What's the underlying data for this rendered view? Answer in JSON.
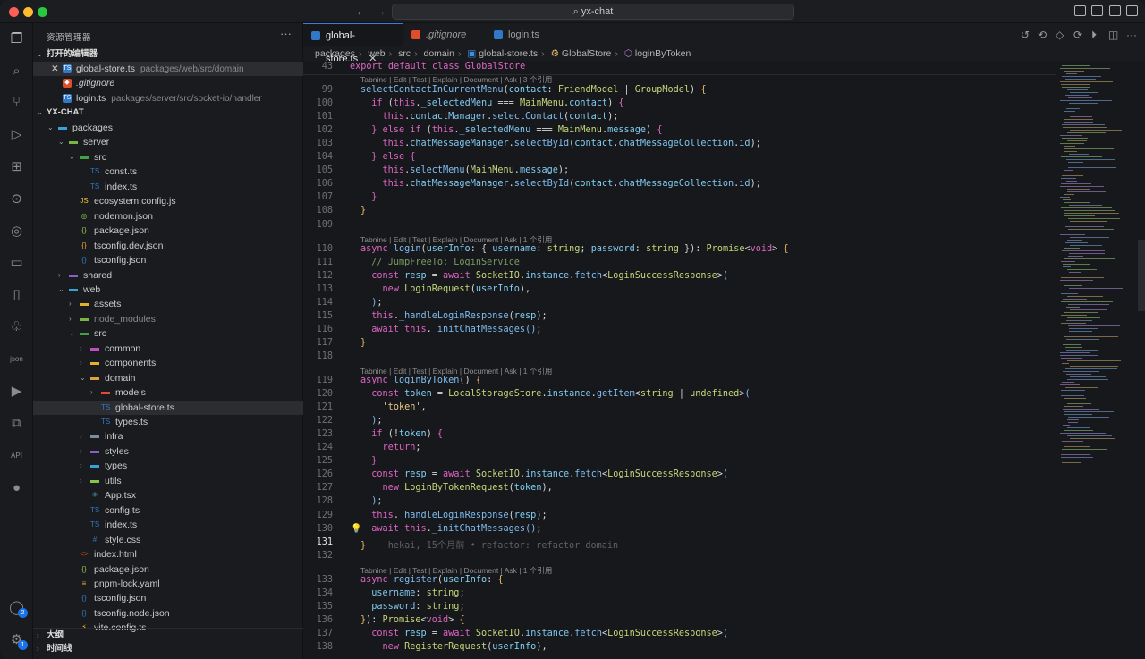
{
  "window": {
    "title": "yx-chat"
  },
  "titlebar": {
    "back_icon": "arrow-left-icon",
    "forward_icon": "arrow-right-icon",
    "search_text": "yx-chat"
  },
  "sidebar": {
    "title": "资源管理器",
    "open_editors_label": "打开的编辑器",
    "open_editors": [
      {
        "name": "global-store.ts",
        "path": "packages/web/src/domain"
      },
      {
        "name": ".gitignore",
        "path": ""
      },
      {
        "name": "login.ts",
        "path": "packages/server/src/socket-io/handler"
      }
    ],
    "workspace_label": "YX-CHAT",
    "tree": [
      {
        "label": "packages"
      },
      {
        "label": "server"
      },
      {
        "label": "src"
      },
      {
        "label": "const.ts"
      },
      {
        "label": "index.ts"
      },
      {
        "label": "ecosystem.config.js"
      },
      {
        "label": "nodemon.json"
      },
      {
        "label": "package.json"
      },
      {
        "label": "tsconfig.dev.json"
      },
      {
        "label": "tsconfig.json"
      },
      {
        "label": "shared"
      },
      {
        "label": "web"
      },
      {
        "label": "assets"
      },
      {
        "label": "node_modules"
      },
      {
        "label": "src"
      },
      {
        "label": "common"
      },
      {
        "label": "components"
      },
      {
        "label": "domain"
      },
      {
        "label": "models"
      },
      {
        "label": "global-store.ts"
      },
      {
        "label": "types.ts"
      },
      {
        "label": "infra"
      },
      {
        "label": "styles"
      },
      {
        "label": "types"
      },
      {
        "label": "utils"
      },
      {
        "label": "App.tsx"
      },
      {
        "label": "config.ts"
      },
      {
        "label": "index.ts"
      },
      {
        "label": "style.css"
      },
      {
        "label": "index.html"
      },
      {
        "label": "package.json"
      },
      {
        "label": "pnpm-lock.yaml"
      },
      {
        "label": "tsconfig.json"
      },
      {
        "label": "tsconfig.node.json"
      },
      {
        "label": "vite.config.ts"
      }
    ],
    "outline_label": "大纲",
    "timeline_label": "时间线"
  },
  "activity": {
    "accounts_badge": "2",
    "settings_badge": "1"
  },
  "tabs": [
    {
      "label": "global-store.ts",
      "close": "✕"
    },
    {
      "label": ".gitignore"
    },
    {
      "label": "login.ts"
    }
  ],
  "breadcrumbs": [
    "packages",
    "web",
    "src",
    "domain",
    "global-store.ts",
    "GlobalStore",
    "loginByToken"
  ],
  "editor": {
    "sticky": {
      "num": "43",
      "text": "export default class GlobalStore"
    },
    "lens_99": "Tabnine | Edit | Test | Explain | Document | Ask | 3 个引用",
    "lens_110": "Tabnine | Edit | Test | Explain | Document | Ask | 1 个引用",
    "lens_119": "Tabnine | Edit | Test | Explain | Document | Ask | 1 个引用",
    "lens_133": "Tabnine | Edit | Test | Explain | Document | Ask | 1 个引用",
    "blame": "hekai, 15个月前 • refactor: refactor domain",
    "line_numbers": [
      "99",
      "100",
      "101",
      "102",
      "103",
      "104",
      "105",
      "106",
      "107",
      "108",
      "109",
      "110",
      "111",
      "112",
      "113",
      "114",
      "115",
      "116",
      "117",
      "118",
      "119",
      "120",
      "121",
      "122",
      "123",
      "124",
      "125",
      "126",
      "127",
      "128",
      "129",
      "130",
      "131",
      "132",
      "133",
      "134",
      "135",
      "136",
      "137",
      "138"
    ]
  }
}
